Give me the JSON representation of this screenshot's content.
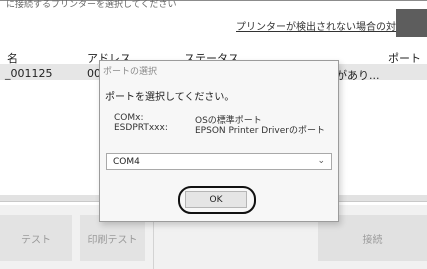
{
  "window": {
    "top_text": "に接続するプリンターを選択してください",
    "help_link": "プリンターが検出されない場合の対処方法"
  },
  "table": {
    "headers": [
      "名",
      "アドレス",
      "ステータス",
      "ポート"
    ],
    "row": {
      "name": "_001125",
      "address": "00:01",
      "status": "があり..."
    }
  },
  "bottom": {
    "test_label": "テスト",
    "print_test_label": "印刷テスト",
    "connect_label": "接続"
  },
  "dialog": {
    "title": "ポートの選択",
    "message": "ポートを選択してください。",
    "ports": [
      {
        "key": "COMx:",
        "value": "OSの標準ポート"
      },
      {
        "key": "ESDPRTxxx:",
        "value": "EPSON Printer Driverのポート"
      }
    ],
    "selected_port": "COM4",
    "ok_label": "OK"
  }
}
